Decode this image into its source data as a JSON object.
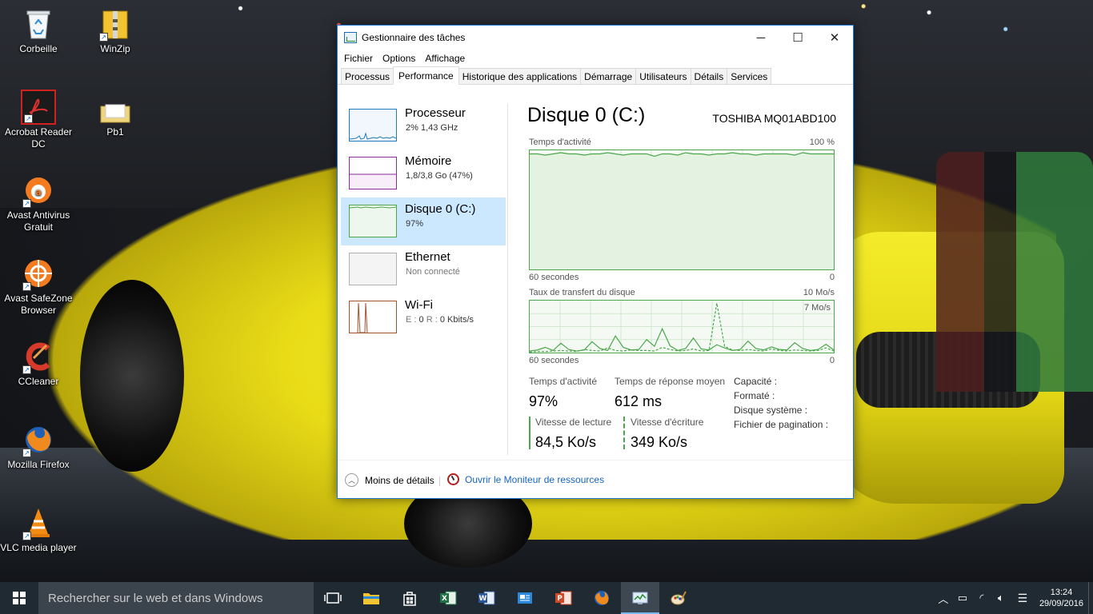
{
  "desktop": {
    "icons": [
      {
        "label": "Corbeille",
        "icon": "recycle-bin-icon"
      },
      {
        "label": "WinZip",
        "icon": "winzip-icon"
      },
      {
        "label": "Acrobat Reader DC",
        "icon": "acrobat-icon"
      },
      {
        "label": "Pb1",
        "icon": "folder-icon"
      },
      {
        "label": "Avast Antivirus Gratuit",
        "icon": "avast-icon"
      },
      {
        "label": "Avast SafeZone Browser",
        "icon": "safezone-icon"
      },
      {
        "label": "CCleaner",
        "icon": "ccleaner-icon"
      },
      {
        "label": "Mozilla Firefox",
        "icon": "firefox-icon"
      },
      {
        "label": "VLC media player",
        "icon": "vlc-icon"
      }
    ]
  },
  "window": {
    "title": "Gestionnaire des tâches",
    "menu": [
      "Fichier",
      "Options",
      "Affichage"
    ],
    "tabs": [
      "Processus",
      "Performance",
      "Historique des applications",
      "Démarrage",
      "Utilisateurs",
      "Détails",
      "Services"
    ],
    "active_tab": "Performance",
    "side": [
      {
        "name": "Processeur",
        "sub": "2% 1,43 GHz",
        "color": "#1f7bc0"
      },
      {
        "name": "Mémoire",
        "sub": "1,8/3,8 Go (47%)",
        "color": "#8b2a9b"
      },
      {
        "name": "Disque 0 (C:)",
        "sub": "97%",
        "color": "#4ca64c"
      },
      {
        "name": "Ethernet",
        "sub": "Non connecté",
        "color": "#a0a0a0"
      },
      {
        "name": "Wi-Fi",
        "sub_e": "E :",
        "sub_e_val": "0",
        "sub_r": "R :",
        "sub_r_val": "0 Kbits/s",
        "color": "#a0522d"
      }
    ],
    "main": {
      "title": "Disque 0 (C:)",
      "model": "TOSHIBA MQ01ABD100",
      "graph1": {
        "label": "Temps d'activité",
        "max": "100 %",
        "time": "60 secondes",
        "min": "0"
      },
      "graph2": {
        "label": "Taux de transfert du disque",
        "max": "10 Mo/s",
        "inner": "7 Mo/s",
        "time": "60 secondes",
        "min": "0"
      },
      "stats": {
        "activity_label": "Temps d'activité",
        "activity_value": "97%",
        "response_label": "Temps de réponse moyen",
        "response_value": "612 ms",
        "read_label": "Vitesse de lecture",
        "read_value": "84,5 Ko/s",
        "write_label": "Vitesse d'écriture",
        "write_value": "349 Ko/s"
      },
      "props": [
        "Capacité :",
        "Formaté :",
        "Disque système :",
        "Fichier de pagination :"
      ]
    },
    "footer": {
      "less": "Moins de détails",
      "monitor": "Ouvrir le Moniteur de ressources"
    }
  },
  "taskbar": {
    "search_placeholder": "Rechercher sur le web et dans Windows",
    "time": "13:24",
    "date": "29/09/2016"
  },
  "chart_data": {
    "type": "line",
    "series": [
      {
        "values": [
          97,
          97,
          96,
          97,
          98,
          97,
          97,
          96,
          97,
          97,
          98,
          97,
          96,
          97,
          97,
          97,
          95,
          97,
          97,
          96,
          98,
          97,
          97,
          96,
          97,
          97,
          98,
          97,
          97,
          96,
          97,
          97,
          97,
          97,
          96,
          98,
          97,
          97,
          97,
          97
        ]
      },
      {
        "values": [
          0.3,
          0.5,
          1.0,
          0.4,
          1.8,
          0.6,
          0.3,
          0.5,
          2.1,
          0.8,
          0.4,
          3.2,
          1.0,
          0.5,
          0.6,
          2.5,
          1.2,
          4.6,
          1.3,
          0.4,
          0.8,
          2.8,
          0.7,
          0.5,
          1.5,
          0.9,
          0.4,
          0.6,
          2.2,
          0.8,
          0.5,
          1.1,
          0.6,
          0.5,
          1.9,
          0.8,
          0.4,
          0.6,
          1.6,
          0.5
        ]
      },
      {
        "values": [
          0.1,
          0.2,
          0.2,
          0.3,
          0.4,
          0.3,
          0.2,
          0.6,
          0.4,
          0.3,
          0.9,
          0.4,
          0.3,
          0.5,
          0.4,
          0.4,
          0.3,
          1.0,
          0.6,
          0.3,
          0.4,
          0.7,
          0.3,
          0.4,
          9.5,
          1.2,
          0.5,
          0.4,
          0.6,
          0.4,
          0.3,
          0.7,
          0.4,
          0.3,
          0.5,
          0.4,
          0.3,
          0.4,
          0.9,
          0.3
        ]
      }
    ],
    "ylim": [
      0,
      10
    ]
  }
}
